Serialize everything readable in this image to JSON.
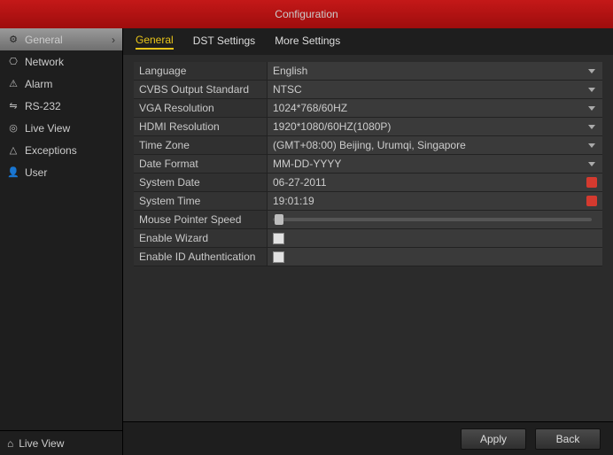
{
  "title": "Configuration",
  "sidebar": {
    "items": [
      {
        "icon": "⚙",
        "label": "General",
        "active": true
      },
      {
        "icon": "⎔",
        "label": "Network"
      },
      {
        "icon": "⚠",
        "label": "Alarm"
      },
      {
        "icon": "⇋",
        "label": "RS-232"
      },
      {
        "icon": "◎",
        "label": "Live View"
      },
      {
        "icon": "△",
        "label": "Exceptions"
      },
      {
        "icon": "👤",
        "label": "User"
      }
    ],
    "bottom": {
      "icon": "⌂",
      "label": "Live View"
    }
  },
  "tabs": [
    {
      "label": "General",
      "active": true
    },
    {
      "label": "DST Settings"
    },
    {
      "label": "More Settings"
    }
  ],
  "settings": {
    "language": {
      "label": "Language",
      "value": "English"
    },
    "cvbs": {
      "label": "CVBS Output Standard",
      "value": "NTSC"
    },
    "vga": {
      "label": "VGA Resolution",
      "value": "1024*768/60HZ"
    },
    "hdmi": {
      "label": "HDMI Resolution",
      "value": "1920*1080/60HZ(1080P)"
    },
    "tz": {
      "label": "Time Zone",
      "value": "(GMT+08:00) Beijing, Urumqi, Singapore"
    },
    "datefmt": {
      "label": "Date Format",
      "value": "MM-DD-YYYY"
    },
    "sysdate": {
      "label": "System Date",
      "value": "06-27-2011"
    },
    "systime": {
      "label": "System Time",
      "value": "19:01:19"
    },
    "mouse": {
      "label": "Mouse Pointer Speed"
    },
    "wizard": {
      "label": "Enable Wizard"
    },
    "idauth": {
      "label": "Enable ID Authentication"
    }
  },
  "buttons": {
    "apply": "Apply",
    "back": "Back"
  }
}
